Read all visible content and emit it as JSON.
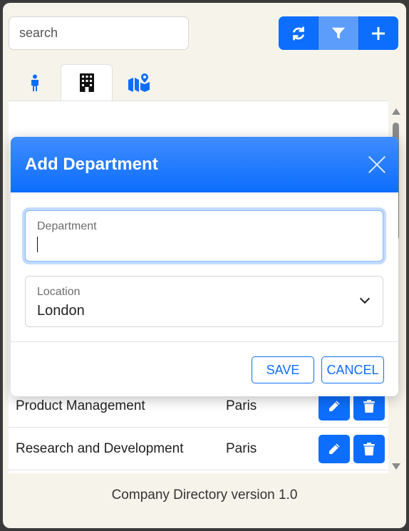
{
  "search": {
    "placeholder": "search"
  },
  "toolbar": {
    "refresh_icon": "refresh-icon",
    "filter_icon": "filter-icon",
    "add_icon": "plus-icon"
  },
  "tabs": [
    {
      "icon": "person-icon",
      "active": false
    },
    {
      "icon": "building-icon",
      "active": true
    },
    {
      "icon": "map-location-icon",
      "active": false
    }
  ],
  "table": {
    "rows": [
      {
        "name": "Product Management",
        "location": "Paris"
      },
      {
        "name": "Research and Development",
        "location": "Paris"
      }
    ]
  },
  "modal": {
    "title": "Add Department",
    "department_label": "Department",
    "department_value": "",
    "location_label": "Location",
    "location_value": "London",
    "save_label": "SAVE",
    "cancel_label": "CANCEL"
  },
  "footer": {
    "text": "Company Directory version 1.0"
  },
  "colors": {
    "primary": "#0d6efd",
    "background": "#f6f3ea"
  }
}
